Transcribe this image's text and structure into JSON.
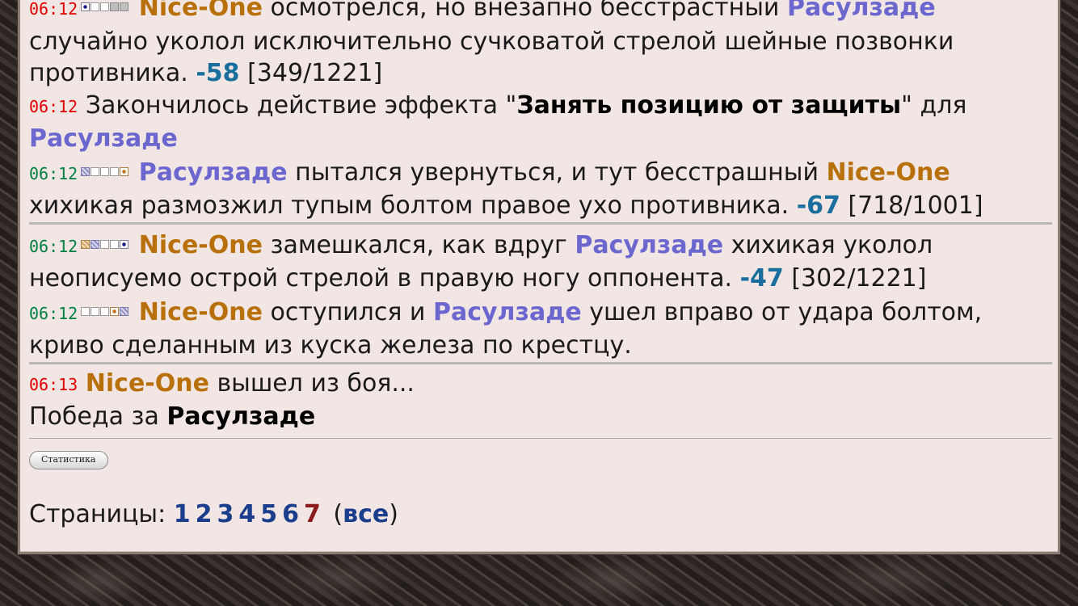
{
  "players": {
    "p1": "Nice-One",
    "p2": "Расулзаде"
  },
  "log": [
    {
      "time": "06:12",
      "t1": " осмотрелся, но внезапно бесстрастный ",
      "t2": "случайно уколол исключительно сучковатой стрелой шейные позвонки противника. ",
      "damage": "-58",
      "hp": " [349/1221]"
    },
    {
      "time": "06:12",
      "t1": "Закончилось действие эффекта \"",
      "effect": "Занять позицию от защиты",
      "t2": "\" для "
    },
    {
      "time": "06:12",
      "t1": " пытался увернуться, и тут бесстрашный ",
      "t2": "хихикая размозжил тупым болтом правое ухо противника. ",
      "damage": "-67",
      "hp": " [718/1001]"
    },
    {
      "time": "06:12",
      "t1": " замешкался, как вдруг ",
      "t2": " хихикая уколол неописуемо острой стрелой в правую ногу оппонента. ",
      "damage": "-47",
      "hp": " [302/1221]"
    },
    {
      "time": "06:12",
      "t1": " оступился и ",
      "t2": " ушел вправо от удара болтом, криво сделанным из куска железа по крестцу."
    },
    {
      "time": "06:13",
      "t1": " вышел из боя..."
    }
  ],
  "victory": {
    "prefix": "Победа за ",
    "winner": "Расулзаде"
  },
  "stats_button": "Статистика",
  "pagination": {
    "label": "Страницы:",
    "pages": [
      "1",
      "2",
      "3",
      "4",
      "5",
      "6",
      "7"
    ],
    "current": "7",
    "all_open": "(",
    "all": "все",
    "all_close": ")"
  }
}
